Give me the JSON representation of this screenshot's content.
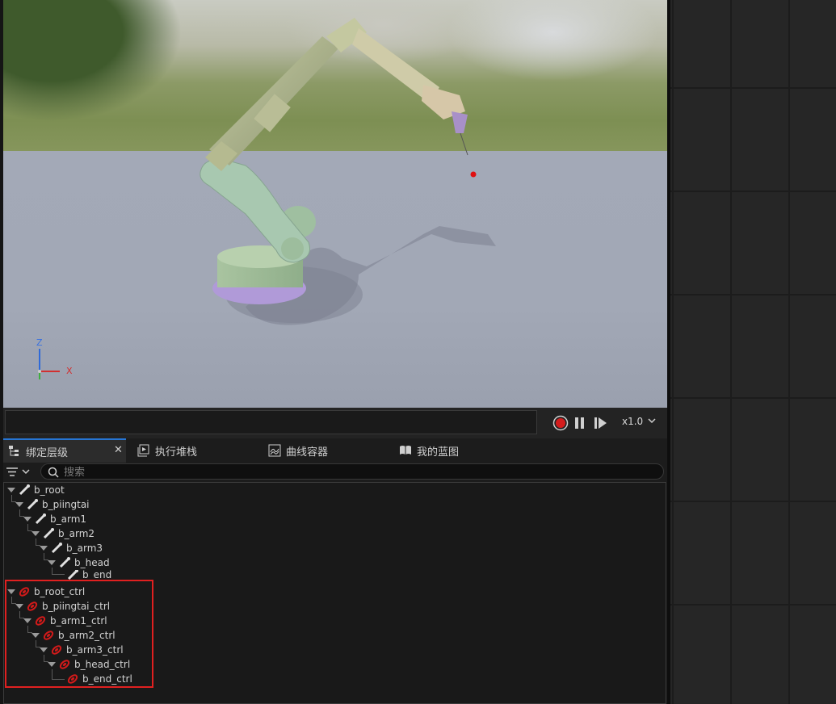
{
  "viewport": {
    "axis": {
      "z": "Z",
      "x": "X"
    }
  },
  "playback": {
    "record_icon": "record-icon",
    "pause_icon": "pause-icon",
    "step_icon": "step-forward-icon",
    "speed": "x1.0"
  },
  "tabs": [
    {
      "label": "绑定层级",
      "icon": "hierarchy-icon",
      "active": true
    },
    {
      "label": "执行堆栈",
      "icon": "execution-stack-icon"
    },
    {
      "label": "曲线容器",
      "icon": "curve-container-icon"
    },
    {
      "label": "我的蓝图",
      "icon": "blueprint-book-icon"
    }
  ],
  "search": {
    "placeholder": "搜索"
  },
  "tree": {
    "bones": [
      "b_root",
      "b_piingtai",
      "b_arm1",
      "b_arm2",
      "b_arm3",
      "b_head",
      "b_end"
    ],
    "controls": [
      "b_root_ctrl",
      "b_piingtai_ctrl",
      "b_arm1_ctrl",
      "b_arm2_ctrl",
      "b_arm3_ctrl",
      "b_head_ctrl",
      "b_end_ctrl"
    ]
  },
  "colors": {
    "accent": "#2675d4",
    "highlight": "#e02020",
    "control_icon": "#d21a1a"
  }
}
